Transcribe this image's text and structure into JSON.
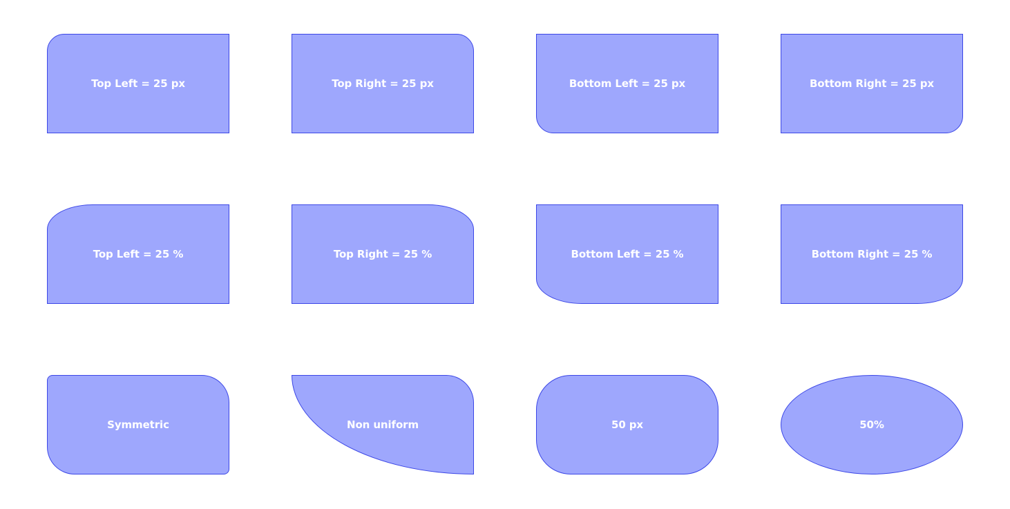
{
  "colors": {
    "fill": "#9ea7fd",
    "stroke": "#3b46e6",
    "label": "#ffffff",
    "background": "#ffffff"
  },
  "boxes": [
    {
      "label": "Top Left = 25 px"
    },
    {
      "label": "Top Right = 25 px"
    },
    {
      "label": "Bottom Left = 25 px"
    },
    {
      "label": "Bottom Right = 25 px"
    },
    {
      "label": "Top Left = 25 %"
    },
    {
      "label": "Top Right = 25 %"
    },
    {
      "label": "Bottom Left = 25 %"
    },
    {
      "label": "Bottom Right = 25 %"
    },
    {
      "label": "Symmetric"
    },
    {
      "label": "Non uniform"
    },
    {
      "label": "50 px"
    },
    {
      "label": "50%"
    }
  ]
}
